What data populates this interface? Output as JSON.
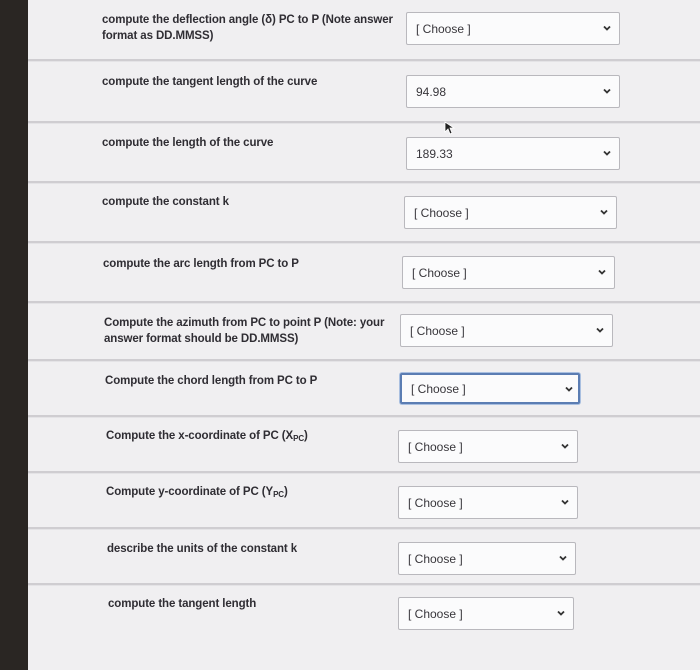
{
  "questions": [
    {
      "id": "q1",
      "pre": "compute the deflection angle (δ) PC to P (Note answer",
      "line2": "format as DD.MMSS)",
      "value": "[ Choose ]"
    },
    {
      "id": "q2",
      "pre": "compute the tangent length of the curve",
      "value": "94.98"
    },
    {
      "id": "q3",
      "pre": "compute the length of the curve",
      "value": "189.33"
    },
    {
      "id": "q4",
      "pre": "compute the constant k",
      "value": "[ Choose ]"
    },
    {
      "id": "q5",
      "pre": "compute the arc length from PC to P",
      "value": "[ Choose ]"
    },
    {
      "id": "q6",
      "pre": "Compute the azimuth from PC to point P (Note: your",
      "line2": "answer format should be DD.MMSS)",
      "value": "[ Choose ]"
    },
    {
      "id": "q7",
      "pre": "Compute the chord length from PC to P",
      "value": "[ Choose ]"
    },
    {
      "id": "q8",
      "pre": "Compute the x-coordinate of PC (X",
      "sub": "PC",
      "post": ")",
      "value": "[ Choose ]"
    },
    {
      "id": "q9",
      "pre": "Compute y-coordinate of PC (Y",
      "sub": "PC",
      "post": ")",
      "value": "[ Choose ]"
    },
    {
      "id": "q10",
      "pre": "describe the units of the constant k",
      "value": "[ Choose ]"
    },
    {
      "id": "q11",
      "pre": "compute the tangent length",
      "value": "[ Choose ]"
    }
  ]
}
